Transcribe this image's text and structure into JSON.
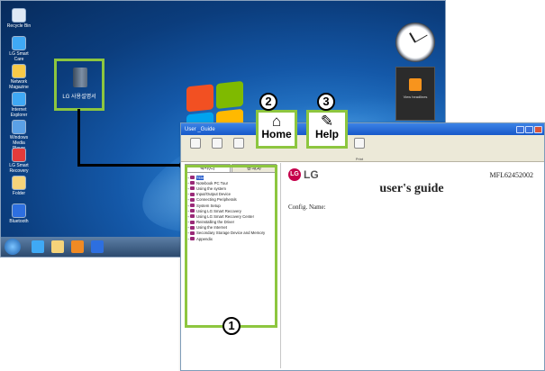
{
  "desktop": {
    "icons": [
      {
        "label": "Recycle Bin",
        "icon": "recycle-bin-icon",
        "color": "#dfe9f5"
      },
      {
        "label": "LG Smart Care",
        "icon": "app-icon",
        "color": "#3fa9f5"
      },
      {
        "label": "Network Magazine",
        "icon": "app-icon",
        "color": "#f7c948"
      },
      {
        "label": "Internet Explorer",
        "icon": "ie-icon",
        "color": "#3fa9f5"
      },
      {
        "label": "Windows Media Player",
        "icon": "app-icon",
        "color": "#5aa0e6"
      },
      {
        "label": "LG Smart Recovery",
        "icon": "app-icon",
        "color": "#e23b3b"
      },
      {
        "label": "Folder",
        "icon": "folder-icon",
        "color": "#f5d37a"
      },
      {
        "label": "Bluetooth",
        "icon": "bluetooth-icon",
        "color": "#2d6fe0"
      }
    ],
    "manual_icon_label": "LG 사용설명서",
    "gadget_label": "View headlines",
    "taskbar_buttons": [
      "ie-icon",
      "folder-icon",
      "media-icon",
      "bluetooth-icon"
    ]
  },
  "window": {
    "title": "User _Guide",
    "toolbar": [
      {
        "label": "",
        "icon": "sync-icon"
      },
      {
        "label": "",
        "icon": "back-icon"
      },
      {
        "label": "",
        "icon": "forward-icon"
      },
      {
        "label": "",
        "icon": "home-icon"
      },
      {
        "label": "",
        "icon": "help-icon"
      },
      {
        "label": "Print",
        "icon": "print-icon"
      }
    ],
    "callouts": {
      "home": {
        "label": "Home",
        "icon": "⌂",
        "number": "2"
      },
      "help": {
        "label": "Help",
        "icon": "✎",
        "number": "3"
      },
      "sidebar_number": "1"
    },
    "sidebar_tabs": [
      "목차(C)",
      "검색(S)"
    ],
    "tree": [
      {
        "label": "Title",
        "selected": true
      },
      {
        "label": "Notebook PC Tour",
        "selected": false
      },
      {
        "label": "Using the system",
        "selected": false
      },
      {
        "label": "Input/Output Device",
        "selected": false
      },
      {
        "label": "Connecting Peripherals",
        "selected": false
      },
      {
        "label": "System Setup",
        "selected": false
      },
      {
        "label": "Using LG Smart Recovery",
        "selected": false
      },
      {
        "label": "Using LG Smart Recovery Center",
        "selected": false
      },
      {
        "label": "Reinstalling the Driver",
        "selected": false
      },
      {
        "label": "Using the Internet",
        "selected": false
      },
      {
        "label": "Secondary Storage Device and Memory",
        "selected": false
      },
      {
        "label": "Appendix",
        "selected": false
      }
    ],
    "content": {
      "logo_mark": "LG",
      "logo_text": "LG",
      "model": "MFL62452002",
      "title": "user's guide",
      "config": "Config. Name:"
    }
  },
  "colors": {
    "highlight": "#8dc63f",
    "lg_red": "#c5004b"
  }
}
